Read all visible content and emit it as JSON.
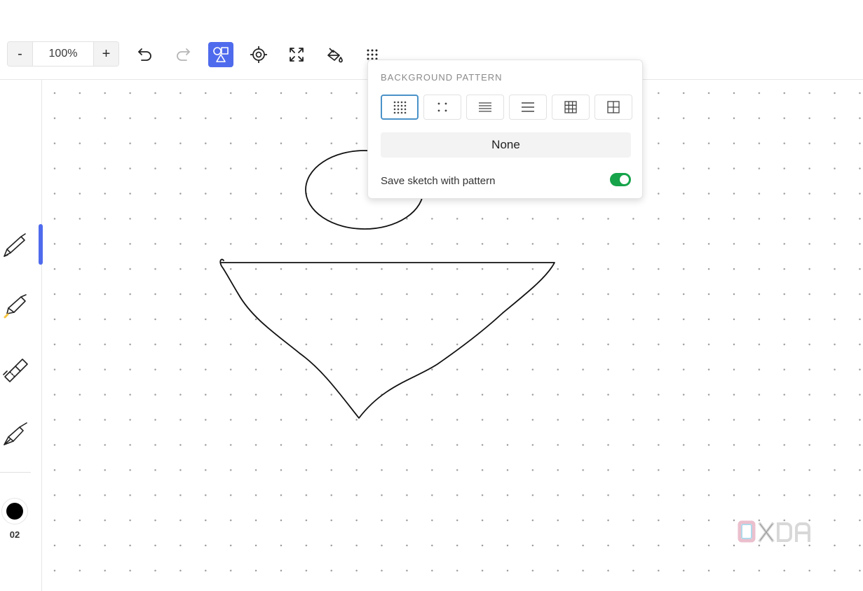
{
  "toolbar": {
    "zoom_out_label": "-",
    "zoom_value": "100%",
    "zoom_in_label": "+",
    "tools": [
      {
        "name": "undo",
        "icon": "undo-icon"
      },
      {
        "name": "redo",
        "icon": "redo-icon"
      },
      {
        "name": "shapes",
        "icon": "shapes-icon",
        "active": true
      },
      {
        "name": "recenter",
        "icon": "crosshair-icon"
      },
      {
        "name": "fit-to-screen",
        "icon": "expand-icon"
      },
      {
        "name": "fill",
        "icon": "paint-bucket-icon"
      },
      {
        "name": "background-pattern",
        "icon": "dot-grid-icon"
      }
    ]
  },
  "sidebar": {
    "tools": [
      {
        "name": "pen",
        "icon": "pen-icon",
        "selected": true
      },
      {
        "name": "highlighter",
        "icon": "highlighter-icon",
        "accent": "#f5c542"
      },
      {
        "name": "eraser",
        "icon": "eraser-icon"
      },
      {
        "name": "calligraphy-pen",
        "icon": "calligraphy-pen-icon"
      }
    ],
    "color": "#000000",
    "size_label": "02"
  },
  "popup": {
    "title": "BACKGROUND PATTERN",
    "patterns": [
      {
        "name": "dense-dots",
        "icon": "dense-dots-icon",
        "selected": true
      },
      {
        "name": "sparse-dots",
        "icon": "sparse-dots-icon"
      },
      {
        "name": "dense-lines",
        "icon": "dense-lines-icon"
      },
      {
        "name": "sparse-lines",
        "icon": "sparse-lines-icon"
      },
      {
        "name": "dense-grid",
        "icon": "dense-grid-icon"
      },
      {
        "name": "sparse-grid",
        "icon": "sparse-grid-icon"
      }
    ],
    "none_label": "None",
    "save_with_pattern_label": "Save sketch with pattern",
    "save_with_pattern_enabled": true
  },
  "colors": {
    "accent": "#4f6bed",
    "toggle_on": "#16a34a",
    "selected_border": "#4a92c8"
  },
  "watermark": {
    "text": "XDA"
  }
}
